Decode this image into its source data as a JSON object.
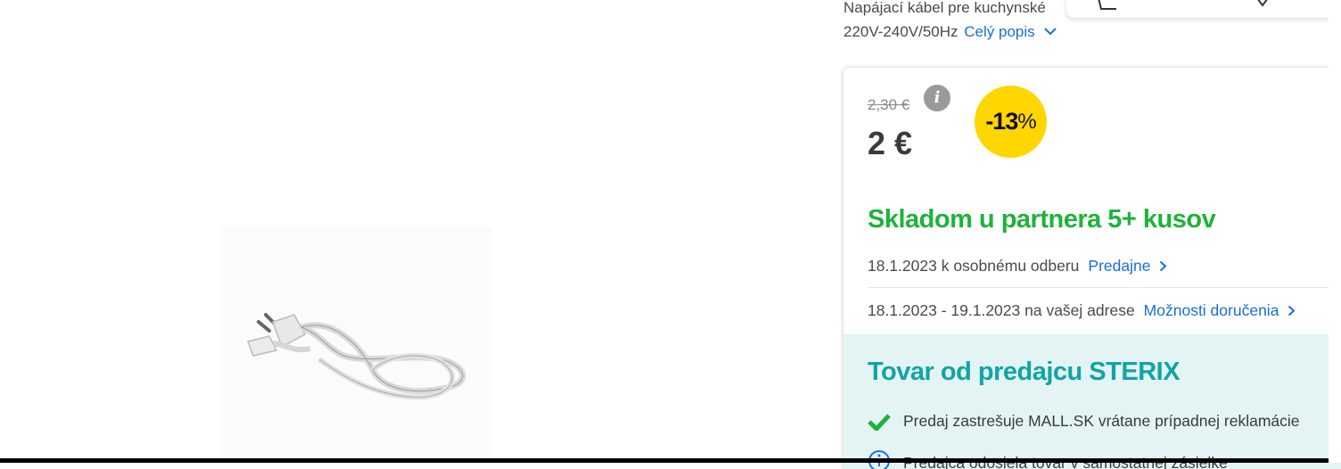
{
  "description": {
    "line1": "Napájací kábel pre kuchynské",
    "line2": "220V-240V/50Hz",
    "full_link": "Celý popis"
  },
  "pricing": {
    "old_price": "2,30 €",
    "price": "2 €",
    "discount_number": "-13",
    "discount_sign": "%"
  },
  "availability": {
    "title": "Skladom u partnera 5+ kusov",
    "pickup_text": "18.1.2023 k osobnému odberu",
    "pickup_link": "Predajne",
    "delivery_text": "18.1.2023 - 19.1.2023 na vašej adrese",
    "delivery_link": "Možnosti doručenia"
  },
  "seller": {
    "title": "Tovar od predajcu STERIX",
    "guarantee": "Predaj zastrešuje MALL.SK vrátane prípadnej reklamácie",
    "shipping": "Predajca odosiela tovar v samostatnej zásielke"
  },
  "colors": {
    "link": "#1a6fd6",
    "stock_green": "#1eb33a",
    "seller_teal": "#12a4a4",
    "badge_yellow": "#ffd600",
    "seller_bg": "#e4f4f4"
  },
  "icons": {
    "info": "info-icon",
    "check": "check-icon",
    "chevron": "chevron-right-icon"
  }
}
